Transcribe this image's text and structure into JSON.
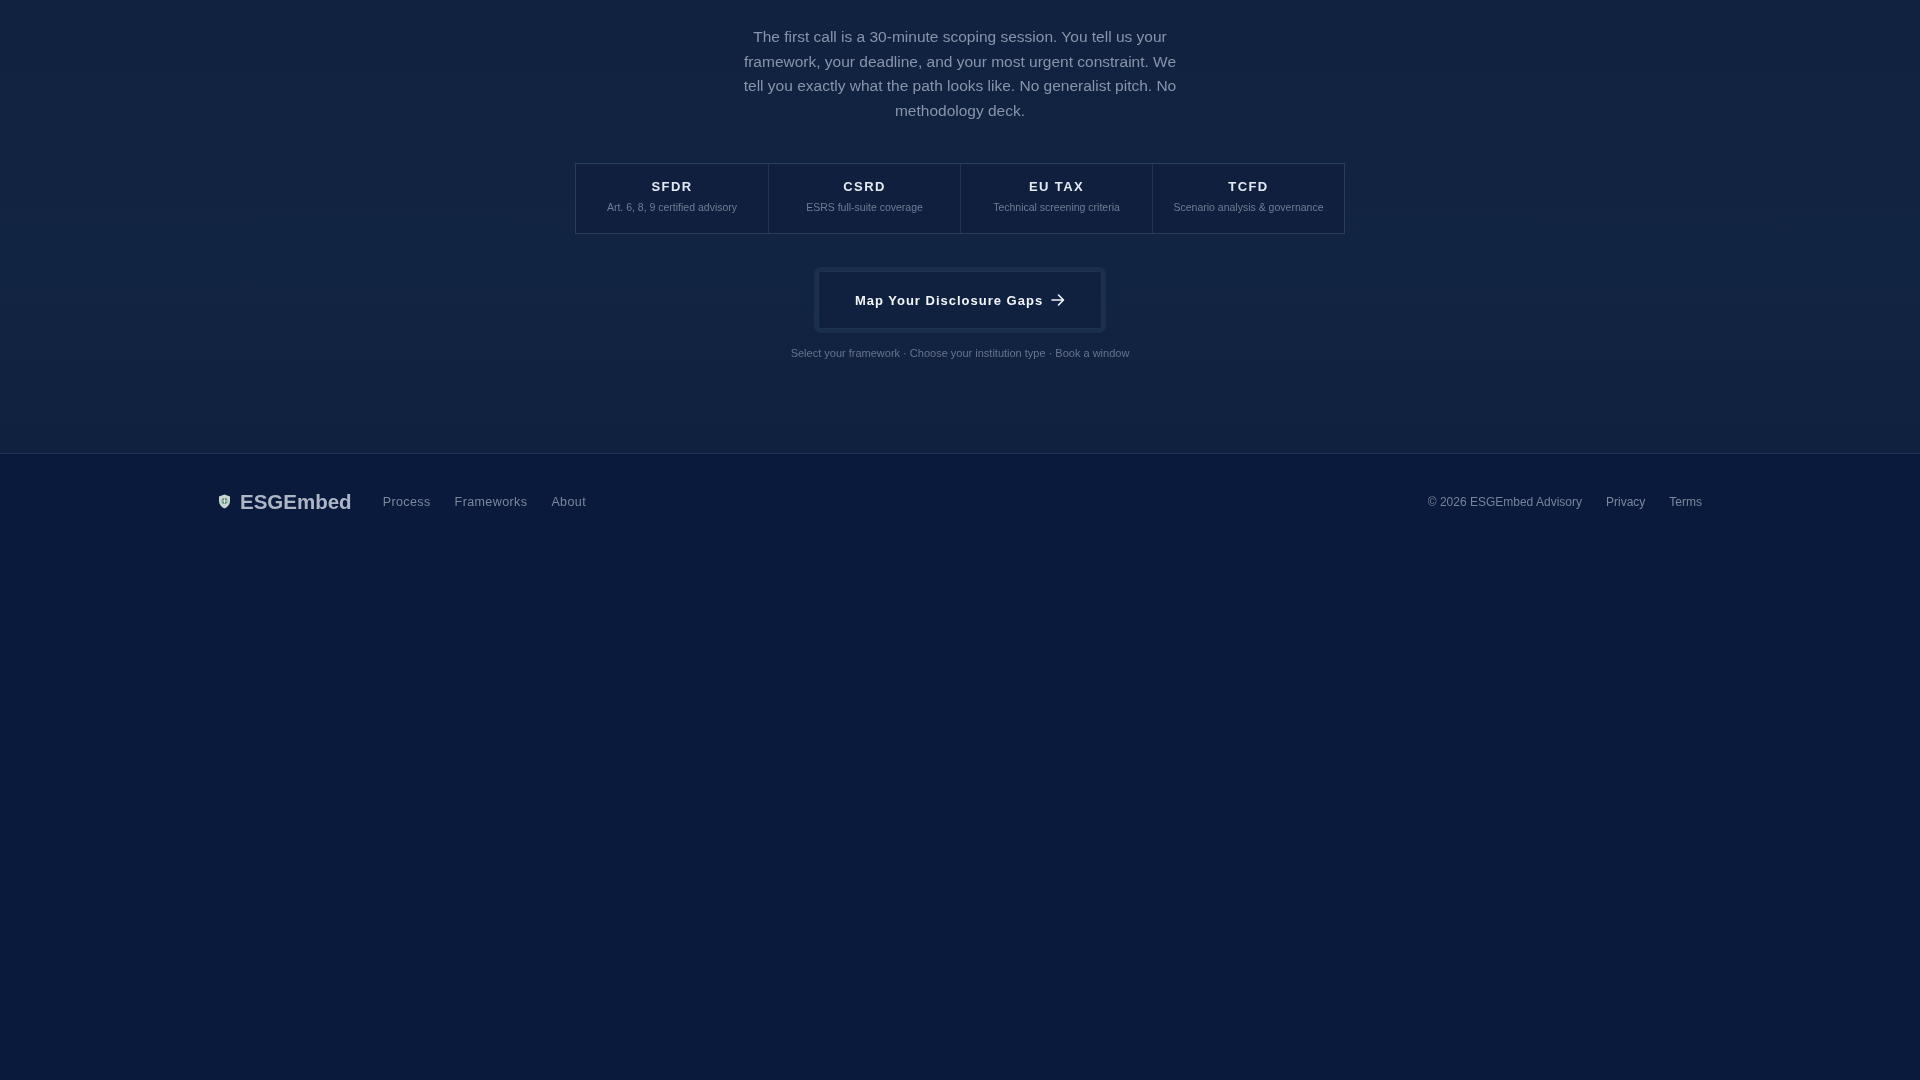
{
  "intro": {
    "text": "The first call is a 30-minute scoping session. You tell us your framework, your deadline, and your most urgent constraint. We tell you exactly what the path looks like. No generalist pitch. No methodology deck."
  },
  "frameworks": [
    {
      "name": "SFDR",
      "description": "Art. 6, 8, 9 certified advisory"
    },
    {
      "name": "CSRD",
      "description": "ESRS full-suite coverage"
    },
    {
      "name": "EU TAX",
      "description": "Technical screening criteria"
    },
    {
      "name": "TCFD",
      "description": "Scenario analysis & governance"
    }
  ],
  "cta": {
    "label": "Map Your Disclosure Gaps",
    "steps": "Select your framework · Choose your institution type · Book a window"
  },
  "footer": {
    "brand": "ESGEmbed",
    "links": [
      "Process",
      "Frameworks",
      "About"
    ],
    "copyright": "© 2026 ESGEmbed Advisory",
    "legal_links": [
      "Privacy",
      "Terms"
    ]
  }
}
